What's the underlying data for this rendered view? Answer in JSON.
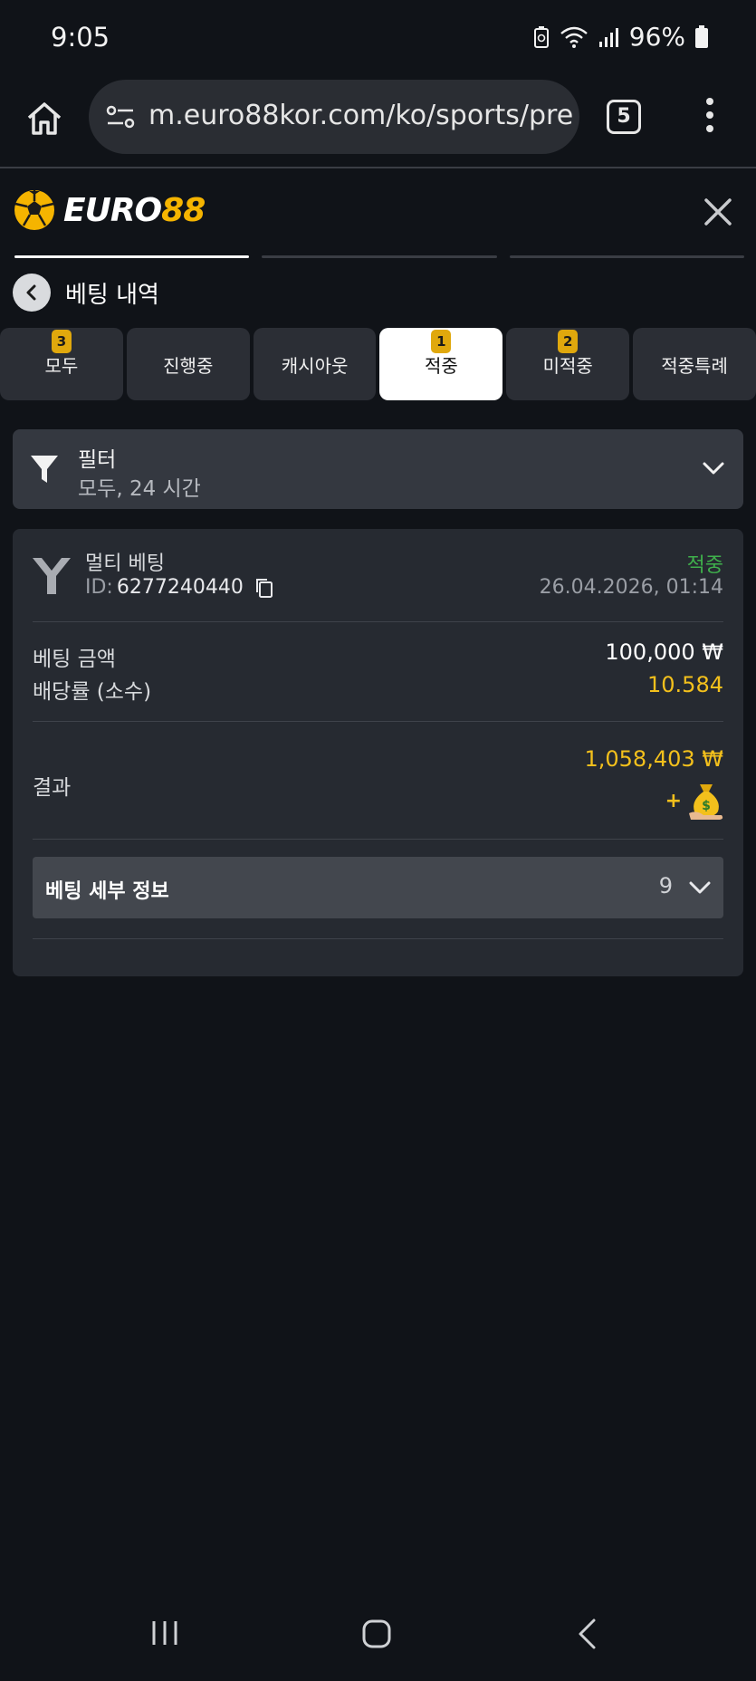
{
  "status_bar": {
    "time": "9:05",
    "battery": "96%",
    "icons": [
      "battery-saver-icon",
      "wifi-icon",
      "signal-icon",
      "battery-icon"
    ]
  },
  "browser": {
    "url": "m.euro88kor.com/ko/sports/pre",
    "tab_count": "5",
    "icons": [
      "home-icon",
      "site-settings-icon",
      "tab-switcher-icon",
      "overflow-menu-icon"
    ]
  },
  "site": {
    "logo_part1": "EURO",
    "logo_part2": "88",
    "brand_color": "#f5b400"
  },
  "page": {
    "title": "베팅 내역"
  },
  "filter_tabs": [
    {
      "label": "모두",
      "badge": "3"
    },
    {
      "label": "진행중",
      "badge": ""
    },
    {
      "label": "캐시아웃",
      "badge": ""
    },
    {
      "label": "적중",
      "badge": "1",
      "active": true
    },
    {
      "label": "미적중",
      "badge": "2"
    },
    {
      "label": "적중특례",
      "badge": ""
    }
  ],
  "filter": {
    "title": "필터",
    "summary": "모두, 24 시간"
  },
  "bet": {
    "type": "멀티 베팅",
    "id_label": "ID:",
    "id": "6277240440",
    "status": "적중",
    "status_color": "#3fb04c",
    "date": "26.04.2026, 01:14",
    "stake_label": "베팅 금액",
    "stake": "100,000 ₩",
    "odds_label": "배당률 (소수)",
    "odds": "10.584",
    "result_label": "결과",
    "result": "1,058,403 ₩",
    "plus": "+",
    "details_label": "베팅 세부 정보",
    "details_count": "9"
  }
}
